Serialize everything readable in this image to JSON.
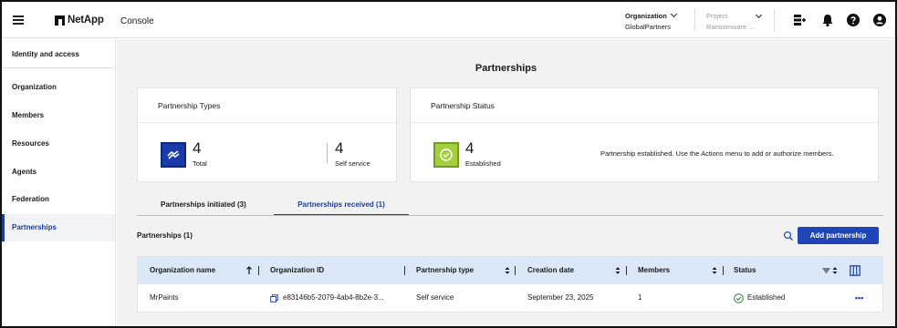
{
  "topbar": {
    "brand": "NetApp",
    "app_title": "Console",
    "organization": {
      "label": "Organization",
      "value": "GlobalPartners"
    },
    "project": {
      "label": "Project",
      "value": "Ransomware ..."
    },
    "icons": [
      "menu-icon",
      "agent-icon",
      "bell-icon",
      "help-icon",
      "user-icon"
    ]
  },
  "sidebar": {
    "items": [
      {
        "label": "Identity and access"
      },
      {
        "label": "Organization"
      },
      {
        "label": "Members"
      },
      {
        "label": "Resources"
      },
      {
        "label": "Agents"
      },
      {
        "label": "Federation"
      },
      {
        "label": "Partnerships",
        "active": true
      }
    ]
  },
  "main": {
    "page_title": "Partnerships",
    "types_card": {
      "title": "Partnership Types",
      "total_value": "4",
      "total_label": "Total",
      "self_value": "4",
      "self_label": "Self service"
    },
    "status_card": {
      "title": "Partnership Status",
      "value": "4",
      "label": "Established",
      "message": "Partnership established. Use the Actions menu to add or authorize members."
    },
    "tabs": [
      {
        "label": "Partnerships initiated (3)"
      },
      {
        "label": "Partnerships received (1)",
        "active": true
      }
    ],
    "list_title": "Partnerships (1)",
    "add_button": "Add partnership",
    "table": {
      "columns": [
        "Organization name",
        "Organization ID",
        "Partnership type",
        "Creation date",
        "Members",
        "Status"
      ],
      "rows": [
        {
          "org_name": "MrPaints",
          "org_id": "e83146b5-2079-4ab4-8b2e-3...",
          "type": "Self service",
          "created": "September 23, 2025",
          "members": "1",
          "status": "Established",
          "actions": "•••"
        }
      ]
    }
  },
  "colors": {
    "accent": "#1d3d9c",
    "button": "#1f45b8",
    "header_row": "#dbe8f7",
    "type_icon": "#1b3bab",
    "status_icon": "#a5cf3c",
    "established": "#2e8a3e"
  }
}
